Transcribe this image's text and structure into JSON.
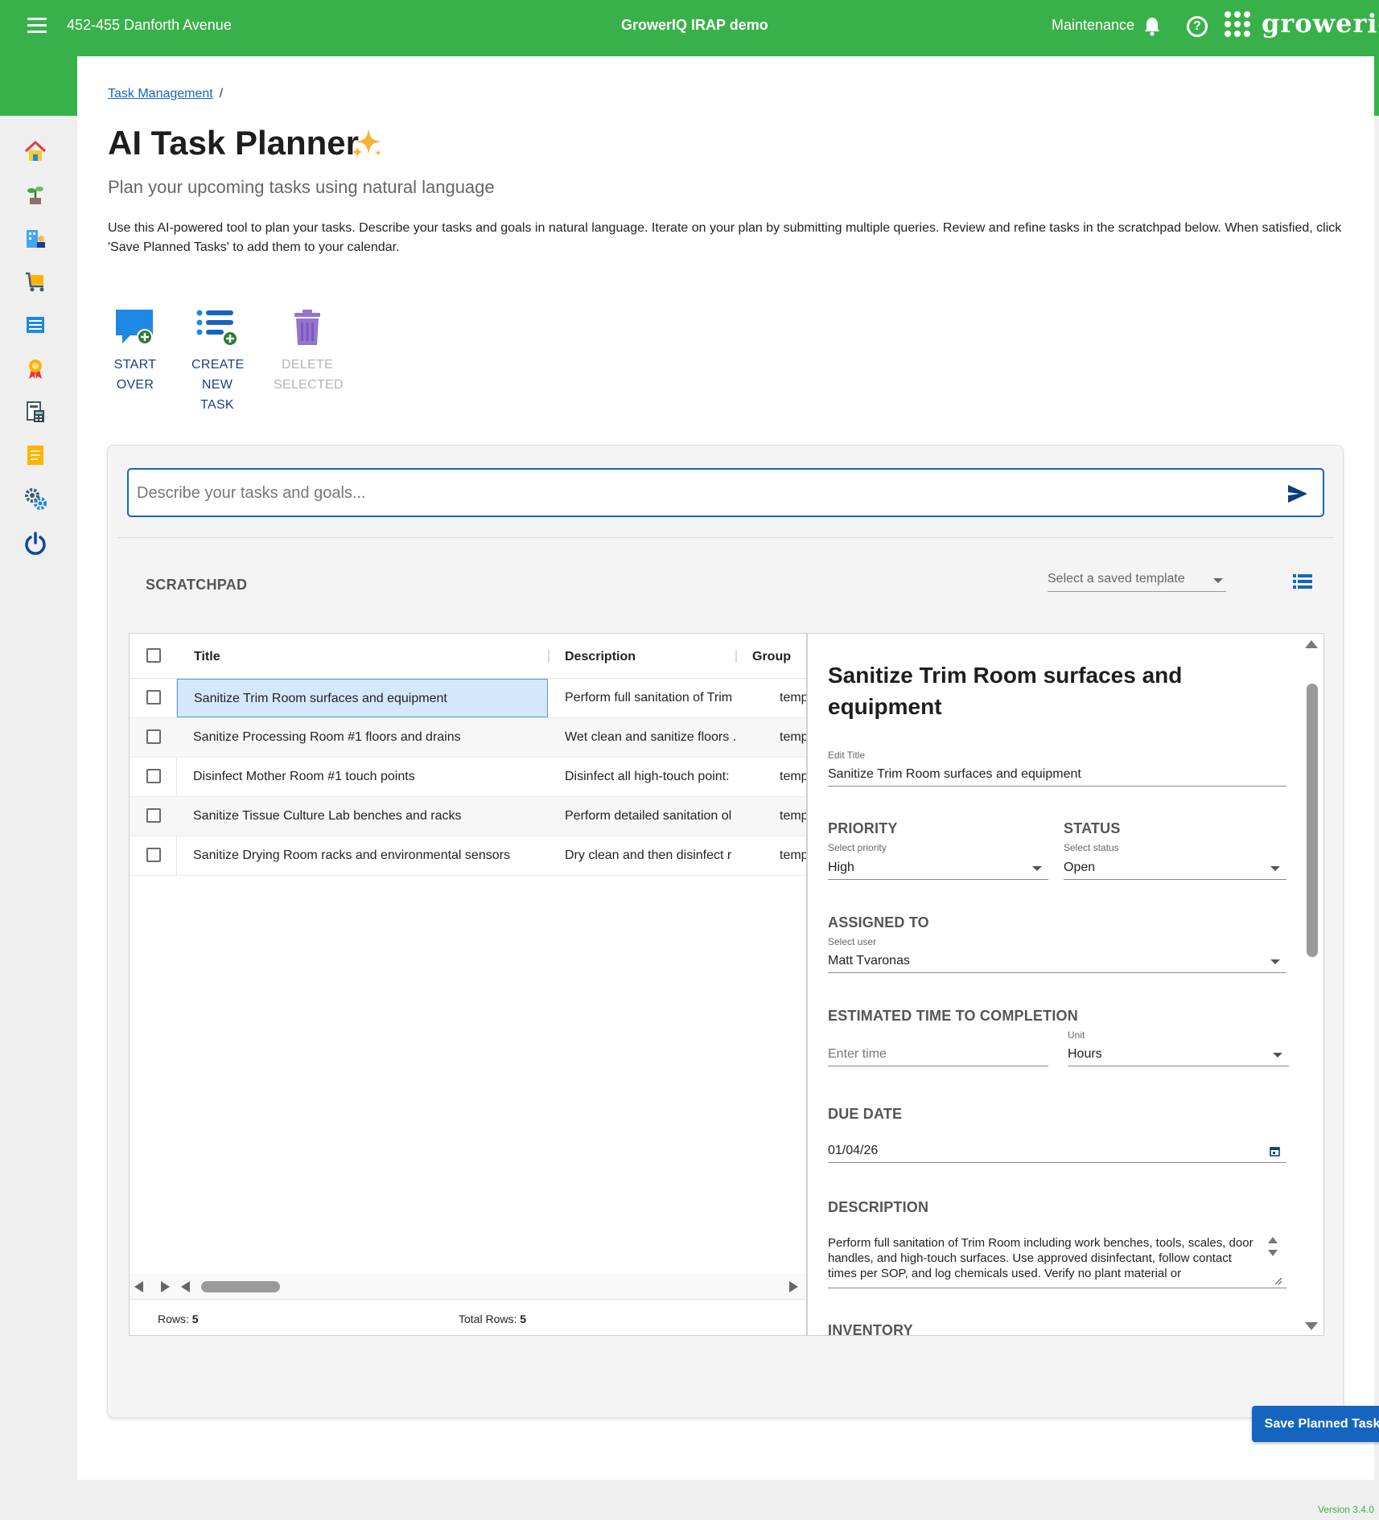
{
  "topbar": {
    "site": "452-455 Danforth Avenue",
    "app_title": "GrowerIQ IRAP demo",
    "maintenance": "Maintenance",
    "logo_text": "groweriq",
    "accent": "#39b14a"
  },
  "sidebar": {
    "items": [
      "home-icon",
      "plant-icon",
      "facility-icon",
      "cart-icon",
      "list-icon",
      "badge-icon",
      "calculator-icon",
      "document-icon",
      "settings-icon",
      "power-icon"
    ]
  },
  "breadcrumb": {
    "link": "Task Management",
    "sep": "/"
  },
  "page": {
    "title": "AI Task Planner",
    "subtitle": "Plan your upcoming tasks using natural language",
    "intro": "Use this AI-powered tool to plan your tasks. Describe your tasks and goals in natural language. Iterate on your plan by submitting multiple queries. Review and refine tasks in the scratchpad below. When satisfied, click 'Save Planned Tasks' to add them to your calendar."
  },
  "actions": {
    "start_over": [
      "START",
      "OVER"
    ],
    "create_task": [
      "CREATE",
      "NEW",
      "TASK"
    ],
    "delete_selected": [
      "DELETE",
      "SELECTED"
    ]
  },
  "query": {
    "placeholder": "Describe your tasks and goals..."
  },
  "scratchpad": {
    "label": "SCRATCHPAD",
    "template_placeholder": "Select a saved template",
    "columns": [
      "Title",
      "Description",
      "Group"
    ],
    "rows": [
      {
        "title": "Sanitize Trim Room surfaces and equipment",
        "description": "Perform full sanitation of Trim",
        "group": "temp",
        "selected": true
      },
      {
        "title": "Sanitize Processing Room #1 floors and drains",
        "description": "Wet clean and sanitize floors .",
        "group": "temp",
        "selected": false
      },
      {
        "title": "Disinfect Mother Room #1 touch points",
        "description": "Disinfect all high-touch point:",
        "group": "temp",
        "selected": false
      },
      {
        "title": "Sanitize Tissue Culture Lab benches and racks",
        "description": "Perform detailed sanitation ol",
        "group": "temp",
        "selected": false
      },
      {
        "title": "Sanitize Drying Room racks and environmental sensors",
        "description": "Dry clean and then disinfect r",
        "group": "temp",
        "selected": false
      }
    ],
    "footer": {
      "rows_label": "Rows:",
      "rows_value": "5",
      "total_label": "Total Rows:",
      "total_value": "5"
    }
  },
  "detail": {
    "heading": "Sanitize Trim Room surfaces and equipment",
    "edit_title_label": "Edit Title",
    "edit_title_value": "Sanitize Trim Room surfaces and equipment",
    "priority_section": "PRIORITY",
    "priority_label": "Select priority",
    "priority_value": "High",
    "status_section": "STATUS",
    "status_label": "Select status",
    "status_value": "Open",
    "assigned_section": "ASSIGNED TO",
    "assigned_label": "Select user",
    "assigned_value": "Matt Tvaronas",
    "eta_section": "ESTIMATED TIME TO COMPLETION",
    "eta_placeholder": "Enter time",
    "unit_label": "Unit",
    "unit_value": "Hours",
    "due_section": "DUE DATE",
    "due_value": "01/04/26",
    "desc_section": "DESCRIPTION",
    "desc_value": "Perform full sanitation of Trim Room including work benches, tools, scales, door handles, and high-touch surfaces. Use approved disinfectant, follow contact times per SOP, and log chemicals used. Verify no plant material or",
    "inventory_section": "INVENTORY"
  },
  "save_button": "Save Planned Tasks",
  "version": "Version 3.4.0"
}
